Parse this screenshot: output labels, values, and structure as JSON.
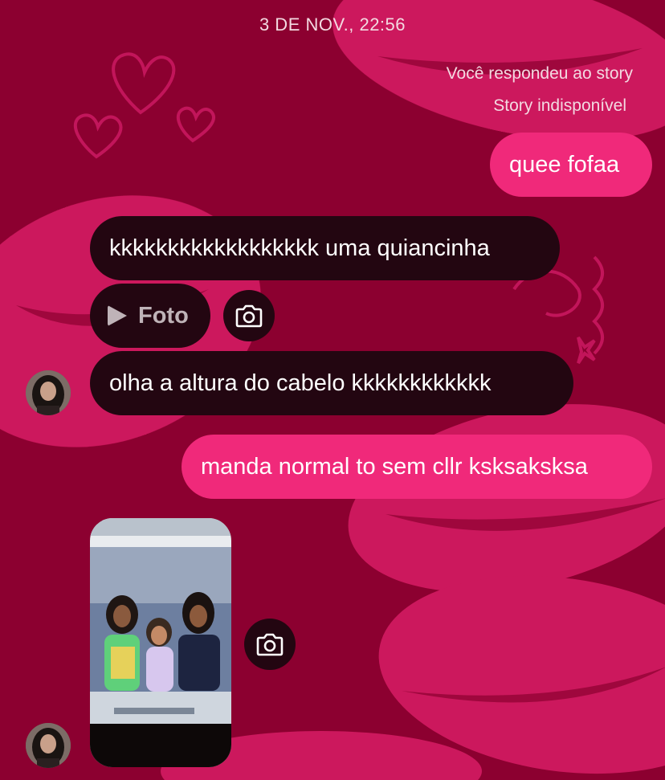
{
  "header": {
    "timestamp": "3 DE NOV., 22:56"
  },
  "story_reply": {
    "note": "Você respondeu ao story",
    "status": "Story indisponível"
  },
  "messages": [
    {
      "direction": "outgoing",
      "text": "quee fofaa"
    },
    {
      "direction": "incoming",
      "text": "kkkkkkkkkkkkkkkkkk uma quiancinha"
    },
    {
      "direction": "incoming",
      "type": "view-once-photo",
      "text": "Foto"
    },
    {
      "direction": "incoming",
      "text": "olha a altura do cabelo kkkkkkkkkkkk"
    },
    {
      "direction": "outgoing",
      "text": "manda normal to sem cllr ksksaksksa"
    },
    {
      "direction": "incoming",
      "type": "photo"
    }
  ],
  "colors": {
    "background": "#8c0030",
    "outgoing_bubble": "#f0297a",
    "incoming_bubble": "#230611",
    "lips_accent": "#d81d66"
  },
  "icons": [
    "play-icon",
    "camera-icon",
    "heart-icon"
  ]
}
